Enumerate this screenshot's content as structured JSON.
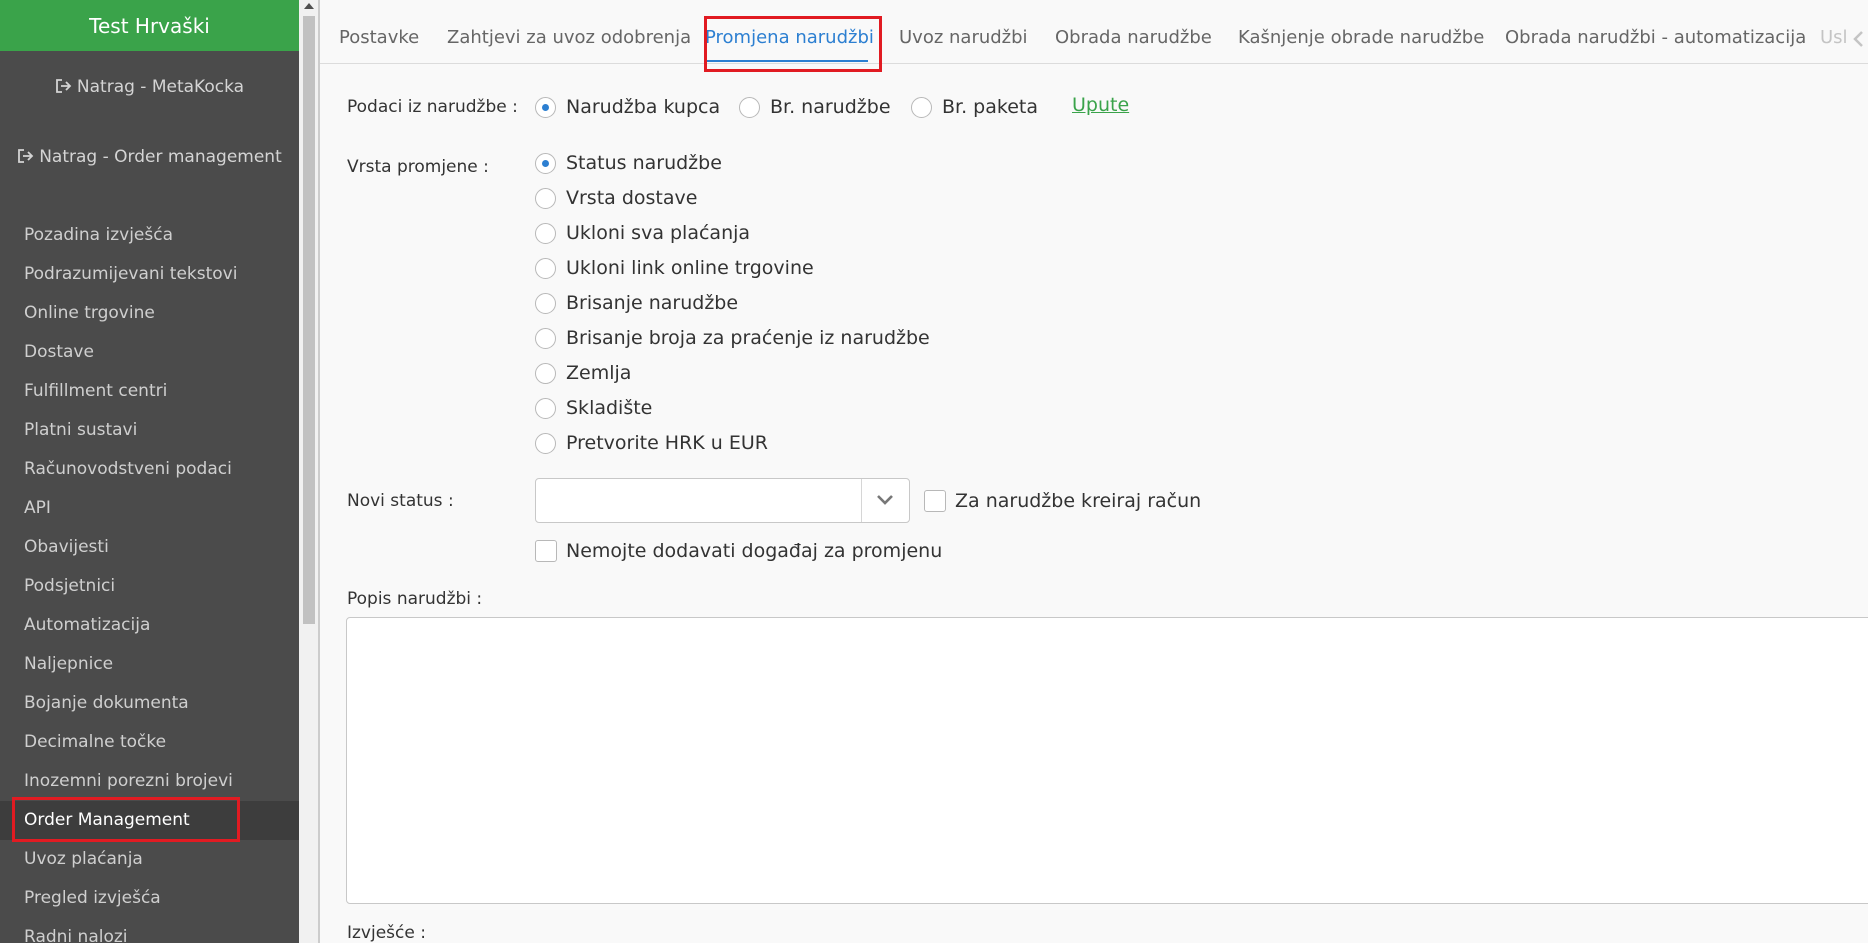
{
  "sidebar": {
    "title": "Test Hrvaški",
    "back_metakocka": "Natrag - MetaKocka",
    "back_order_mgmt": "Natrag - Order management",
    "items": [
      {
        "label": "Pozadina izvješća"
      },
      {
        "label": "Podrazumijevani tekstovi"
      },
      {
        "label": "Online trgovine"
      },
      {
        "label": "Dostave"
      },
      {
        "label": "Fulfillment centri"
      },
      {
        "label": "Platni sustavi"
      },
      {
        "label": "Računovodstveni podaci"
      },
      {
        "label": "API"
      },
      {
        "label": "Obavijesti"
      },
      {
        "label": "Podsjetnici"
      },
      {
        "label": "Automatizacija"
      },
      {
        "label": "Naljepnice"
      },
      {
        "label": "Bojanje dokumenta"
      },
      {
        "label": "Decimalne točke"
      },
      {
        "label": "Inozemni porezni brojevi"
      },
      {
        "label": "Order Management",
        "active": true
      },
      {
        "label": "Uvoz plaćanja"
      },
      {
        "label": "Pregled izvješća"
      },
      {
        "label": "Radni nalozi"
      }
    ]
  },
  "tabs": [
    {
      "label": "Postavke"
    },
    {
      "label": "Zahtjevi za uvoz odobrenja"
    },
    {
      "label": "Promjena narudžbi",
      "active": true
    },
    {
      "label": "Uvoz narudžbi"
    },
    {
      "label": "Obrada narudžbe"
    },
    {
      "label": "Kašnjenje obrade narudžbe"
    },
    {
      "label": "Obrada narudžbi - automatizacija"
    },
    {
      "label": "Usl"
    }
  ],
  "form": {
    "source_label": "Podaci iz narudžbe :",
    "source_options": [
      {
        "label": "Narudžba kupca",
        "selected": true
      },
      {
        "label": "Br. narudžbe",
        "selected": false
      },
      {
        "label": "Br. paketa",
        "selected": false
      }
    ],
    "instructions_link": "Upute",
    "change_type_label": "Vrsta promjene :",
    "change_type_options": [
      {
        "label": "Status narudžbe",
        "selected": true
      },
      {
        "label": "Vrsta dostave",
        "selected": false
      },
      {
        "label": "Ukloni sva plaćanja",
        "selected": false
      },
      {
        "label": "Ukloni link online trgovine",
        "selected": false
      },
      {
        "label": "Brisanje narudžbe",
        "selected": false
      },
      {
        "label": "Brisanje broja za praćenje iz narudžbe",
        "selected": false
      },
      {
        "label": "Zemlja",
        "selected": false
      },
      {
        "label": "Skladište",
        "selected": false
      },
      {
        "label": "Pretvorite HRK u EUR",
        "selected": false
      }
    ],
    "new_status_label": "Novi status :",
    "new_status_value": "",
    "create_invoice_label": "Za narudžbe kreiraj račun",
    "create_invoice_checked": false,
    "no_event_label": "Nemojte dodavati događaj za promjenu",
    "no_event_checked": false,
    "orders_list_label": "Popis narudžbi :",
    "orders_list_value": "",
    "report_label": "Izvješće :"
  },
  "colors": {
    "sidebar_bg": "#4b4b4b",
    "sidebar_header": "#3aa34a",
    "accent_blue": "#2c7fd1",
    "highlight_red": "#e11b22",
    "link_green": "#3aa34a"
  }
}
